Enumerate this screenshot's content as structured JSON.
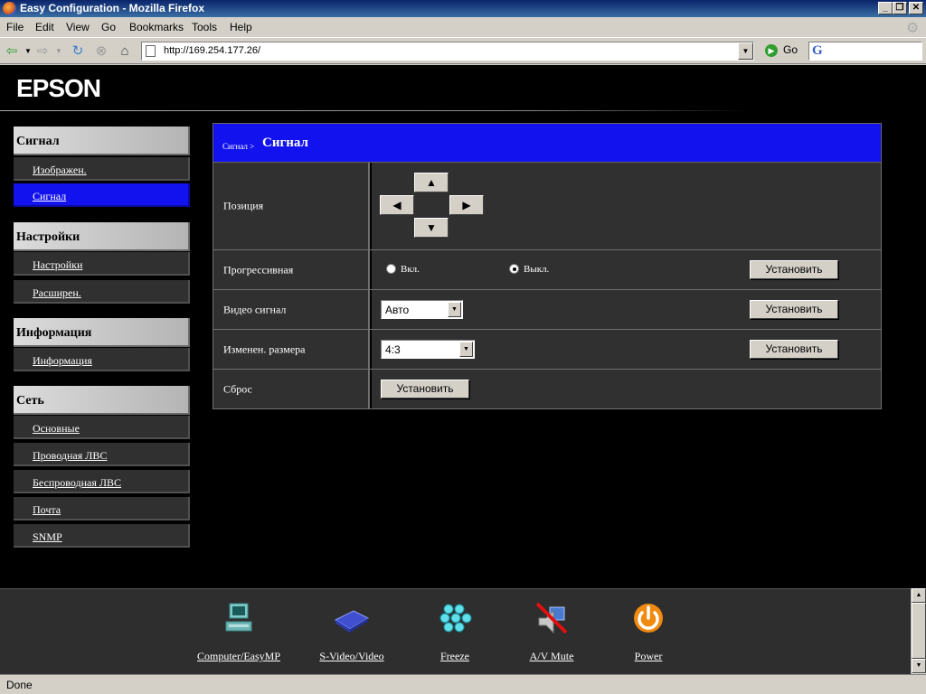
{
  "window": {
    "title": "Easy Configuration - Mozilla Firefox"
  },
  "menubar": {
    "items": [
      "File",
      "Edit",
      "View",
      "Go",
      "Bookmarks",
      "Tools",
      "Help"
    ]
  },
  "navbar": {
    "url": "http://169.254.177.26/",
    "go_label": "Go"
  },
  "brand": {
    "logo": "EPSON"
  },
  "sidebar": {
    "signal_header": "Сигнал",
    "signal_items": [
      "Изображен.",
      "Сигнал"
    ],
    "settings_header": "Настройки",
    "settings_items": [
      "Настройки",
      "Расширен."
    ],
    "info_header": "Информация",
    "info_items": [
      "Информация"
    ],
    "network_header": "Сеть",
    "network_items": [
      "Основные",
      "Проводная ЛВС",
      "Беспроводная ЛВС",
      "Почта",
      "SNMP"
    ],
    "active_item": "Сигнал"
  },
  "panel": {
    "breadcrumb": "Сигнал >",
    "title": "Сигнал",
    "position_label": "Позиция",
    "progressive_label": "Прогрессивная",
    "progressive_on": "Вкл.",
    "progressive_off": "Выкл.",
    "progressive_selected": "Выкл.",
    "video_label": "Видео сигнал",
    "video_value": "Авто",
    "resize_label": "Изменен. размера",
    "resize_value": "4:3",
    "reset_label": "Сброс",
    "set_button": "Установить"
  },
  "toolbar": {
    "items": [
      "Computer/EasyMP",
      "S-Video/Video",
      "Freeze",
      "A/V Mute",
      "Power"
    ]
  },
  "status": {
    "text": "Done"
  }
}
